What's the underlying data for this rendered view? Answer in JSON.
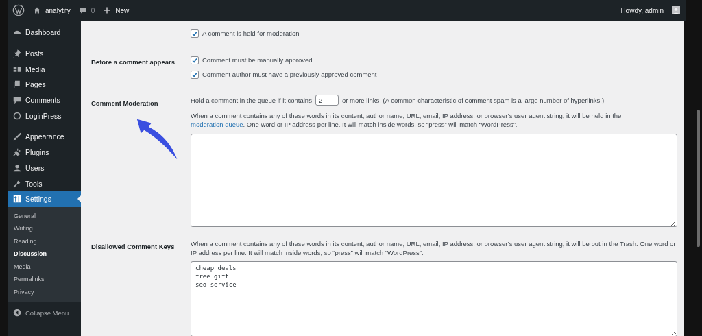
{
  "admin_bar": {
    "site": "analytify",
    "comments_count": "0",
    "new_label": "New",
    "greeting": "Howdy, admin"
  },
  "sidebar": {
    "groups": [
      [
        {
          "label": "Dashboard",
          "selected": false
        }
      ],
      [
        {
          "label": "Posts",
          "selected": false
        },
        {
          "label": "Media",
          "selected": false
        },
        {
          "label": "Pages",
          "selected": false
        },
        {
          "label": "Comments",
          "selected": false
        },
        {
          "label": "LoginPress",
          "selected": false
        }
      ],
      [
        {
          "label": "Appearance",
          "selected": false
        },
        {
          "label": "Plugins",
          "selected": false
        },
        {
          "label": "Users",
          "selected": false
        },
        {
          "label": "Tools",
          "selected": false
        },
        {
          "label": "Settings",
          "selected": true
        }
      ]
    ],
    "submenu": [
      {
        "label": "General",
        "selected": false
      },
      {
        "label": "Writing",
        "selected": false
      },
      {
        "label": "Reading",
        "selected": false
      },
      {
        "label": "Discussion",
        "selected": true
      },
      {
        "label": "Media",
        "selected": false
      },
      {
        "label": "Permalinks",
        "selected": false
      },
      {
        "label": "Privacy",
        "selected": false
      }
    ],
    "collapse_label": "Collapse Menu"
  },
  "settings": [
    {
      "kind": "checkboxes",
      "options": [
        {
          "text": "A comment is held for moderation",
          "checked": true
        }
      ]
    },
    {
      "kind": "checkboxes",
      "label": "Before a comment appears",
      "options": [
        {
          "text": "Comment must be manually approved",
          "checked": true
        },
        {
          "text": "Comment author must have a previously approved comment",
          "checked": true
        }
      ]
    },
    {
      "kind": "moderation",
      "label": "Comment Moderation",
      "hold_before": "Hold a comment in the queue if it contains",
      "links_value": "2",
      "hold_after": "or more links. (A common characteristic of comment spam is a large number of hyperlinks.)",
      "description_before": "When a comment contains any of these words in its content, author name, URL, email, IP address, or browser’s user agent string, it will be held in the",
      "link": "moderation queue",
      "description_after": ". One word or IP address per line. It will match inside words, so “press” will match “WordPress”."
    },
    {
      "kind": "keys",
      "label": "Disallowed Comment Keys",
      "description": "When a comment contains any of these words in its content, author name, URL, email, IP address, or browser’s user agent string, it will be put in the Trash. One word or IP address per line. It will match inside words, so “press” will match “WordPress”.",
      "textarea_value": "cheap deals\nfree gift\nseo service"
    }
  ]
}
